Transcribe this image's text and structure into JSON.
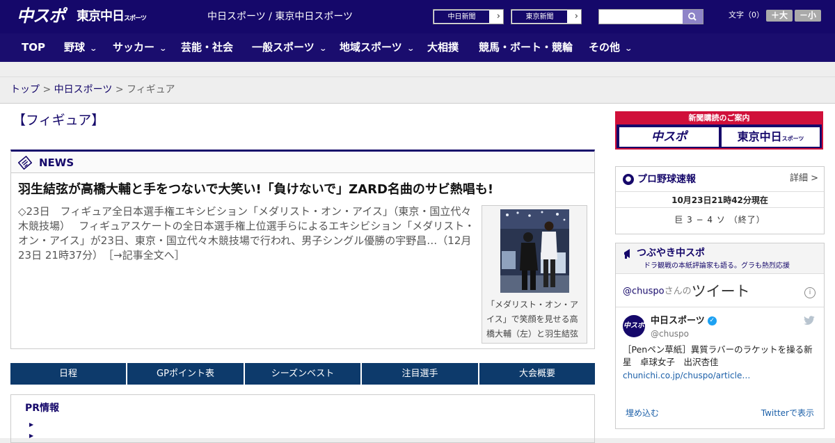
{
  "header": {
    "logo_main": "中スポ",
    "logo_sub": "東京中日",
    "logo_sub_small": "スポーツ",
    "tagline": "中日スポーツ / 東京中日スポーツ",
    "paper_links": [
      "中日新聞",
      "東京新聞"
    ],
    "search_placeholder": "",
    "font_size_label": "文字（0）",
    "font_plus": "＋大",
    "font_minus": "－小"
  },
  "nav": {
    "items": [
      {
        "label": "TOP",
        "dropdown": false
      },
      {
        "label": "野球",
        "dropdown": true
      },
      {
        "label": "サッカー",
        "dropdown": true
      },
      {
        "label": "芸能・社会",
        "dropdown": false
      },
      {
        "label": "一般スポーツ",
        "dropdown": true
      },
      {
        "label": "地域スポーツ",
        "dropdown": true
      },
      {
        "label": "大相撲",
        "dropdown": false
      },
      {
        "label": "競馬・ボート・競輪",
        "dropdown": false
      },
      {
        "label": "その他",
        "dropdown": true
      }
    ]
  },
  "breadcrumb": {
    "items": [
      "トップ",
      "中日スポーツ",
      "フィギュア"
    ],
    "sep": " > "
  },
  "page": {
    "title": "【フィギュア】"
  },
  "news": {
    "label": "NEWS",
    "headline": "羽生結弦が高橋大輔と手をつないで大笑い!「負けないで」ZARD名曲のサビ熱唱も!",
    "body": "◇23日　フィギュア全日本選手権エキシビション「メダリスト・オン・アイス」（東京・国立代々木競技場）　 フィギュアスケートの全日本選手権上位選手らによるエキシビション「メダリスト・オン・アイス」が23日、東京・国立代々木競技場で行われ、男子シングル優勝の宇野昌…（12月23日 21時37分）　［→記事全文へ］",
    "caption": "「メダリスト・オン・アイス」で笑顔を見せる高橋大輔（左）と羽生結弦"
  },
  "tabs": [
    "日程",
    "GPポイント表",
    "シーズンベスト",
    "注目選手",
    "大会概要"
  ],
  "pr": {
    "title": "PR情報"
  },
  "ad": {
    "top": "新聞購読のご案内",
    "logo1": "中スポ",
    "logo2": "東京中日",
    "logo2_small": "スポーツ"
  },
  "baseball": {
    "title": "プロ野球速報",
    "more": "詳細 >",
    "time": "10月23日21時42分現在",
    "score": "巨 3 − 4 ソ （終了）"
  },
  "twitter": {
    "title": "つぶやき中スポ",
    "subtitle": "ドラ観戦の本紙評論家も語る。グラも熱烈応援",
    "handle_link": "@chuspo",
    "san": "さんの",
    "tweets_word": "ツイート",
    "user_name": "中日スポーツ",
    "user_handle": "@chuspo",
    "avatar_text": "中スポ",
    "tweet_text": "［Penペン草紙］異質ラバーのラケットを操る新星　卓球女子　出沢杏佳",
    "tweet_link": "chunichi.co.jp/chuspo/article…",
    "embed": "埋め込む",
    "view": "Twitterで表示"
  }
}
